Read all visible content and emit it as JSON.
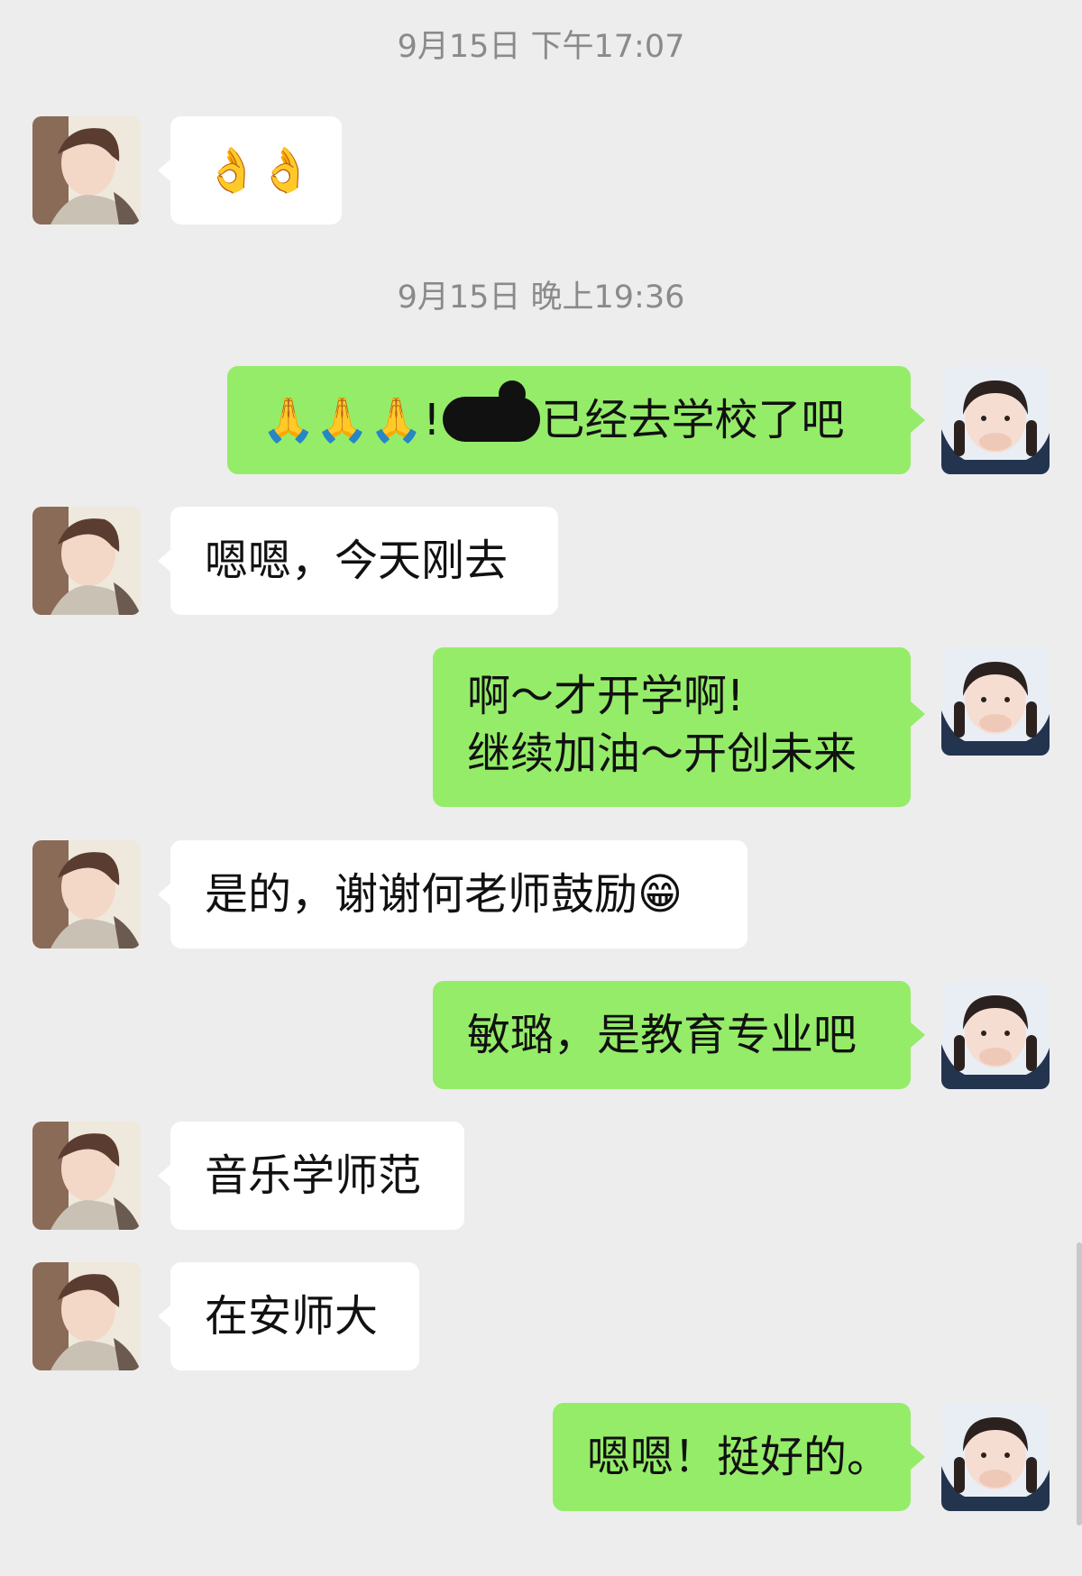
{
  "timestamps": [
    "9月15日 下午17:07",
    "9月15日 晚上19:36"
  ],
  "messages": [
    {
      "side": "left",
      "text": "👌👌"
    },
    {
      "side": "right",
      "pre": "🙏🙏🙏!",
      "post": "已经去学校了吧",
      "redacted": true
    },
    {
      "side": "left",
      "text": "嗯嗯，今天刚去"
    },
    {
      "side": "right",
      "line1": "啊～才开学啊!",
      "line2": "继续加油～开创未来"
    },
    {
      "side": "left",
      "text": "是的，谢谢何老师鼓励😁"
    },
    {
      "side": "right",
      "text": "敏璐，是教育专业吧"
    },
    {
      "side": "left",
      "text": "音乐学师范"
    },
    {
      "side": "left",
      "text": "在安师大"
    },
    {
      "side": "right",
      "text": "嗯嗯！挺好的。"
    }
  ],
  "colors": {
    "background": "#ededed",
    "bubble_self": "#95ec69",
    "bubble_other": "#ffffff",
    "timestamp": "#8a8a8a"
  }
}
